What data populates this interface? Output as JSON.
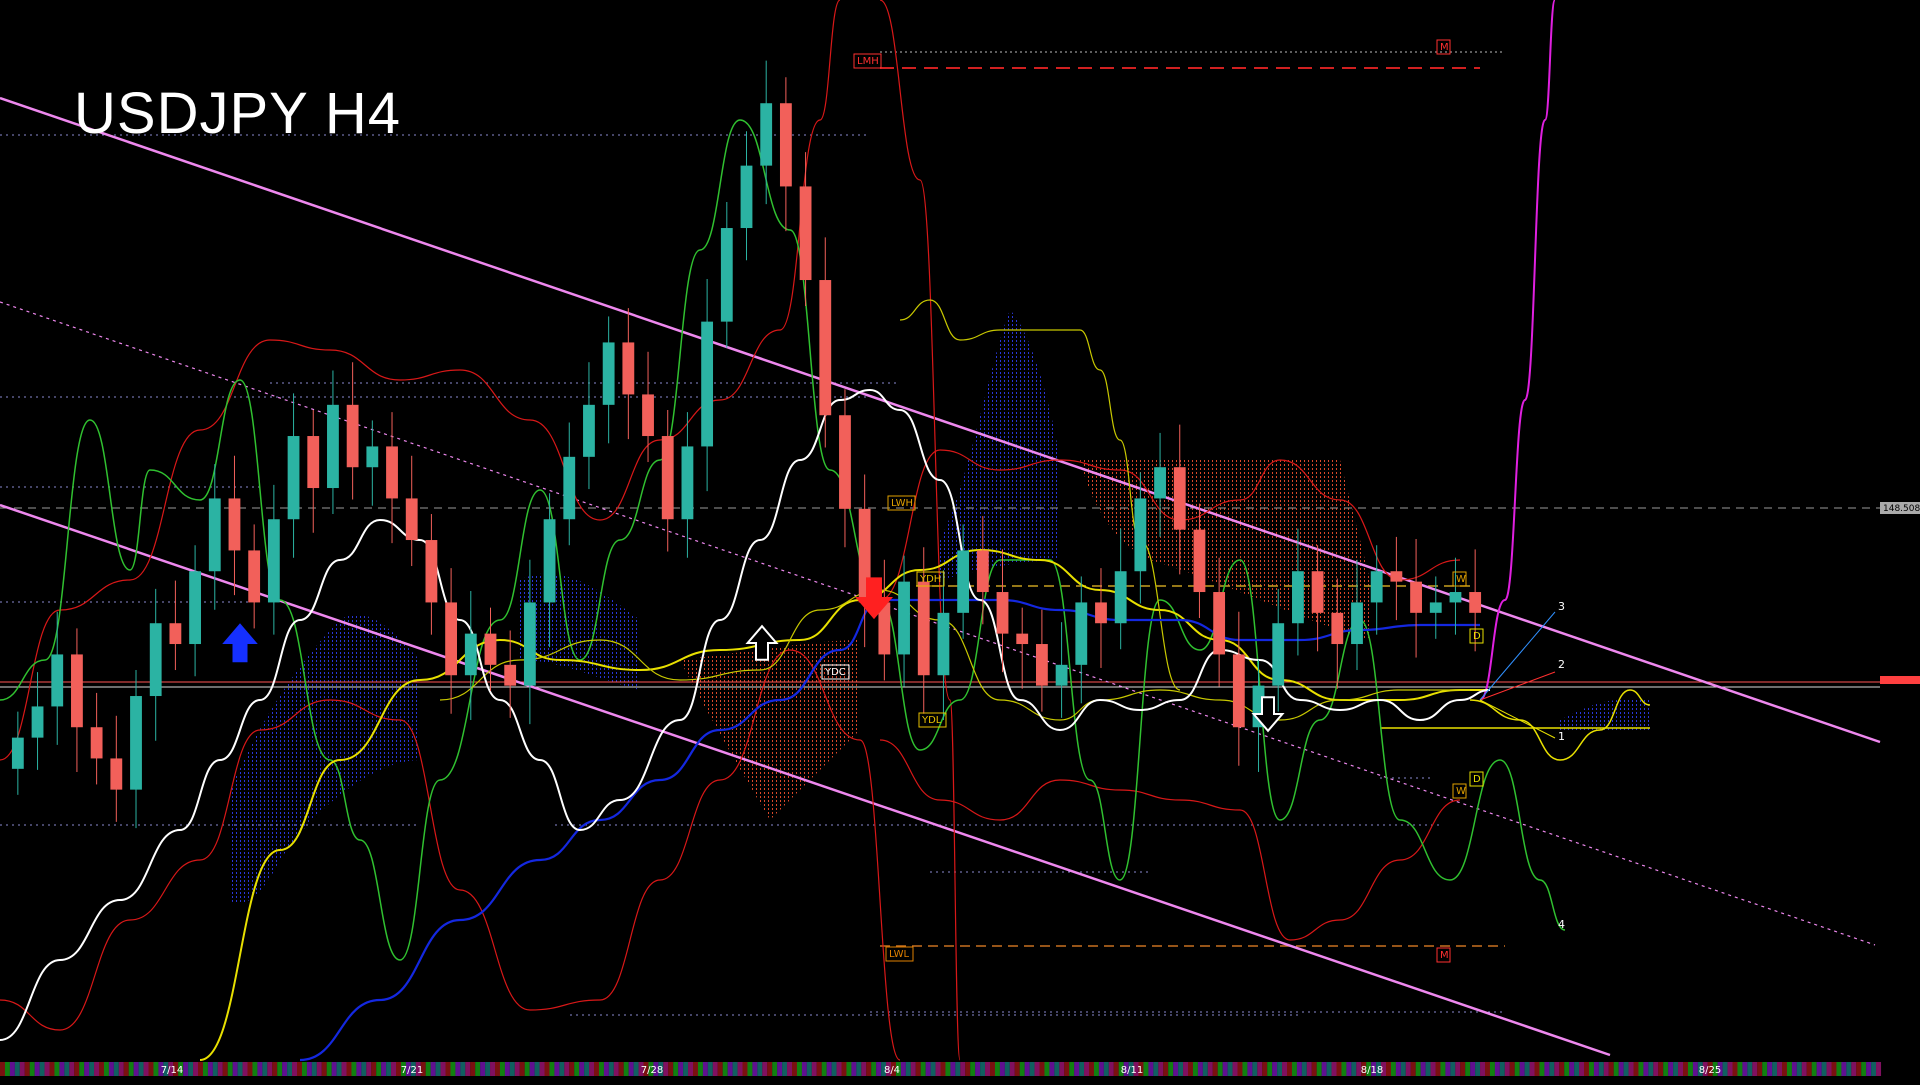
{
  "chart_data": {
    "type": "candlestick",
    "title": "USDJPY H4",
    "xlabel": "",
    "ylabel": "",
    "price_tag": "148.508",
    "date_labels": [
      "7/14",
      "7/21",
      "7/28",
      "8/4",
      "8/11",
      "8/18",
      "8/25"
    ],
    "level_labels": [
      "LWH",
      "YDH",
      "YDC",
      "YDL",
      "LWL",
      "LMH",
      "M",
      "M",
      "W",
      "W",
      "D",
      "D"
    ],
    "wave_labels": [
      "1",
      "2",
      "3",
      "4"
    ],
    "candles_close": [
      146.3,
      146.6,
      147.1,
      146.4,
      146.1,
      145.8,
      146.7,
      147.4,
      147.2,
      147.9,
      148.6,
      148.1,
      147.6,
      148.4,
      149.2,
      148.7,
      149.5,
      148.9,
      149.1,
      148.6,
      148.2,
      147.6,
      146.9,
      147.3,
      147.0,
      146.8,
      147.6,
      148.4,
      149.0,
      149.5,
      150.1,
      149.6,
      149.2,
      148.4,
      149.1,
      150.3,
      151.2,
      151.8,
      152.4,
      151.6,
      150.7,
      149.4,
      148.5,
      147.6,
      147.1,
      147.8,
      146.9,
      147.5,
      148.1,
      147.7,
      147.3,
      147.2,
      146.8,
      147.0,
      147.6,
      147.4,
      147.9,
      148.6,
      148.9,
      148.3,
      147.7,
      147.1,
      146.4,
      146.8,
      147.4,
      147.9,
      147.5,
      147.2,
      147.6,
      147.9,
      147.8,
      147.5,
      147.6,
      147.7,
      147.5
    ],
    "candle_colors": {
      "bull": "#2bb3a3",
      "bear": "#f2605a"
    },
    "colors": {
      "channel": "#ee88ee",
      "ma_white": "#ffffff",
      "ma_yellow": "#e8e000",
      "ma_blue": "#1428e0",
      "bollinger": "#d81818",
      "oscillator": "#30c030",
      "cloud_blue": "#2a3aff",
      "cloud_red": "#ff4a30",
      "level_label": "#e0a000",
      "price_line": "#ff5050"
    }
  }
}
